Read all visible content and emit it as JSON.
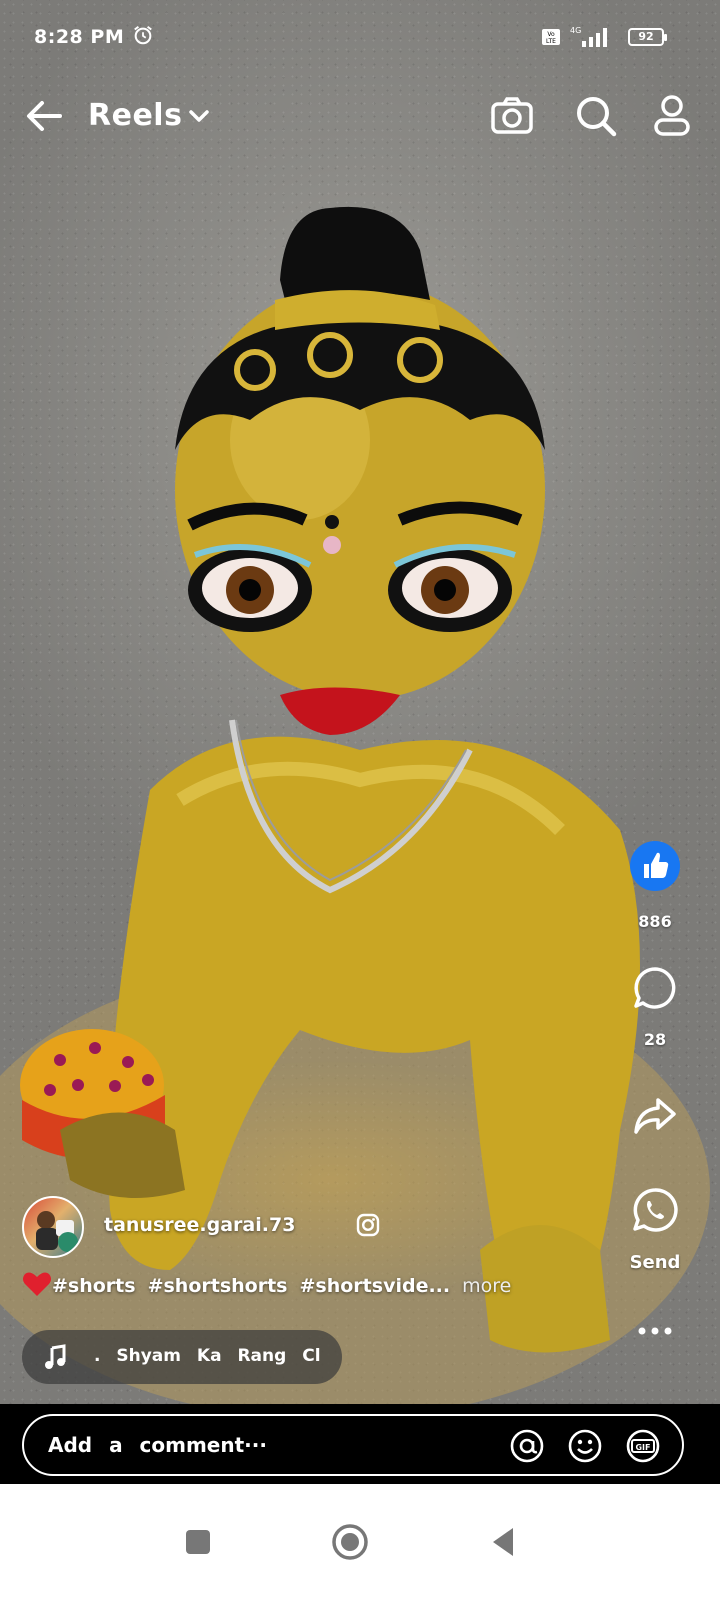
{
  "status_bar": {
    "time": "8:28",
    "meridiem": "PM",
    "network": "VoLTE 4G",
    "battery": "92"
  },
  "top_bar": {
    "title": "Reels"
  },
  "actions": {
    "like_count": "886",
    "comment_count": "28",
    "whatsapp_label": "Send"
  },
  "post": {
    "username": "tanusree.garai.73",
    "hashtags": [
      "#shorts",
      "#shortshorts",
      "#shortsvide..."
    ],
    "more_label": "more",
    "music": ". Shyam Ka Rang Cl"
  },
  "comment_bar": {
    "placeholder": "Add a comment···"
  },
  "icons": [
    "back-arrow-icon",
    "chevron-down-icon",
    "camera-icon",
    "search-icon",
    "profile-icon",
    "like-icon",
    "comment-icon",
    "share-icon",
    "whatsapp-icon",
    "more-icon",
    "instagram-icon",
    "heart-icon",
    "music-note-icon",
    "mention-icon",
    "emoji-icon",
    "gif-icon",
    "alarm-icon"
  ],
  "colors": {
    "like_blue": "#1877f2",
    "heart_red": "#e0202e"
  }
}
